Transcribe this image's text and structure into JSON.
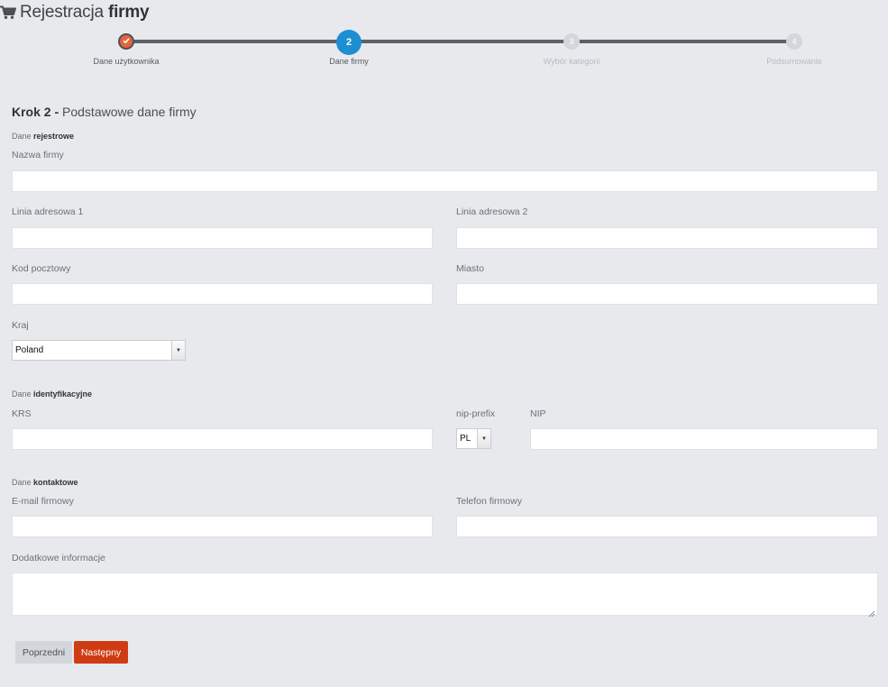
{
  "header": {
    "icon": "cart-icon",
    "title_light": "Rejestracja",
    "title_bold": "firmy"
  },
  "stepper": {
    "steps": [
      {
        "number": "1",
        "label": "Dane użytkownika",
        "state": "done",
        "icon": "check-icon"
      },
      {
        "number": "2",
        "label": "Dane firmy",
        "state": "active"
      },
      {
        "number": "3",
        "label": "Wybór kategorii",
        "state": "todo"
      },
      {
        "number": "4",
        "label": "Podsumowanie",
        "state": "todo"
      }
    ],
    "colors": {
      "done": "#e8623a",
      "active": "#1b8fd2",
      "todo": "#d3d7db",
      "line": "#59626b"
    }
  },
  "form": {
    "heading_bold": "Krok 2 -",
    "heading_rest": "Podstawowe dane firmy",
    "sections": {
      "register": {
        "prefix": "Dane",
        "bold": "rejestrowe"
      },
      "identification": {
        "prefix": "Dane",
        "bold": "identyfikacyjne"
      },
      "contact": {
        "prefix": "Dane",
        "bold": "kontaktowe"
      }
    },
    "fields": {
      "company_name": {
        "label": "Nazwa firmy",
        "value": ""
      },
      "address1": {
        "label": "Linia adresowa 1",
        "value": ""
      },
      "address2": {
        "label": "Linia adresowa 2",
        "value": ""
      },
      "postal_code": {
        "label": "Kod pocztowy",
        "value": ""
      },
      "city": {
        "label": "Miasto",
        "value": ""
      },
      "country": {
        "label": "Kraj",
        "value": "Poland"
      },
      "krs": {
        "label": "KRS",
        "value": ""
      },
      "nip_prefix": {
        "label": "nip-prefix",
        "value": "PL"
      },
      "nip": {
        "label": "NIP",
        "value": ""
      },
      "email": {
        "label": "E-mail firmowy",
        "value": ""
      },
      "phone": {
        "label": "Telefon firmowy",
        "value": ""
      },
      "additional_info": {
        "label": "Dodatkowe informacje",
        "value": ""
      }
    },
    "buttons": {
      "prev": "Poprzedni",
      "next": "Następny"
    },
    "colors": {
      "next_button": "#cf3c14",
      "prev_button": "#d3d7db",
      "background": "#e7e9ec"
    }
  }
}
